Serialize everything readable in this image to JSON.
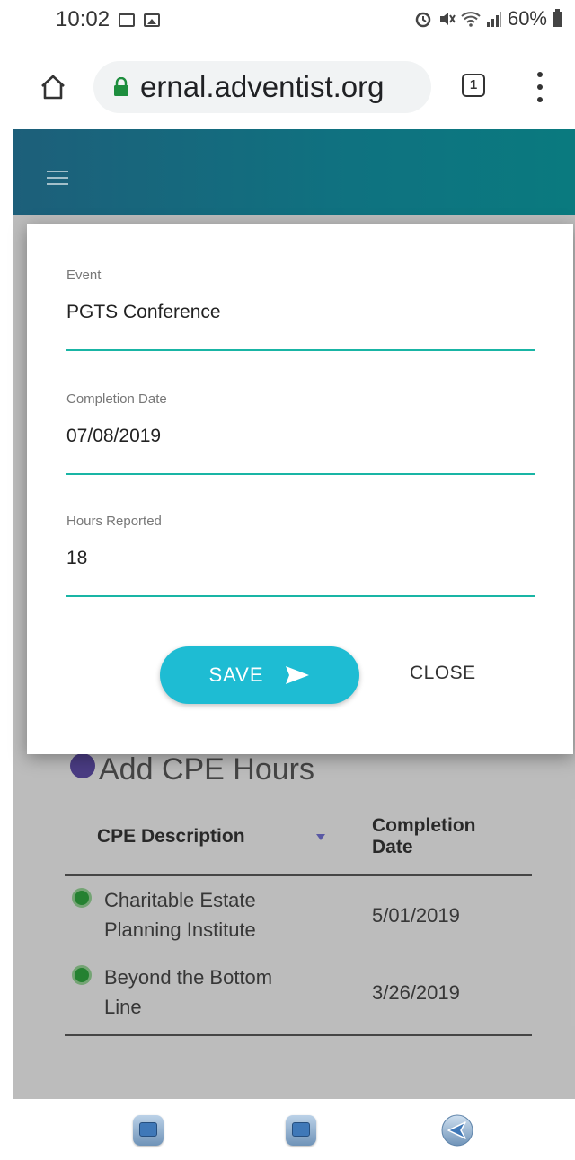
{
  "status_bar": {
    "time": "10:02",
    "battery": "60%",
    "notification_icons": [
      "message-icon",
      "gallery-icon"
    ],
    "system_icons": [
      "alarm-icon",
      "mute-icon",
      "wifi-icon",
      "signal-icon",
      "battery-icon"
    ]
  },
  "browser": {
    "url": "ernal.adventist.org",
    "tab_count": "1"
  },
  "dialog": {
    "fields": [
      {
        "label": "Event",
        "value": "PGTS Conference"
      },
      {
        "label": "Completion Date",
        "value": "07/08/2019"
      },
      {
        "label": "Hours Reported",
        "value": "18"
      }
    ],
    "save_label": "SAVE",
    "close_label": "CLOSE"
  },
  "page": {
    "heading": "Add CPE Hours",
    "table": {
      "columns": [
        "CPE Description",
        "Completion Date"
      ],
      "rows": [
        {
          "description": "Charitable Estate Planning Institute",
          "date": "5/01/2019"
        },
        {
          "description": "Beyond the Bottom Line",
          "date": "3/26/2019"
        }
      ]
    }
  },
  "colors": {
    "accent_teal": "#19b5a5",
    "save_button": "#1ebcd3",
    "header_gradient_start": "#1d5f7a",
    "status_green": "#2e9e3c"
  }
}
